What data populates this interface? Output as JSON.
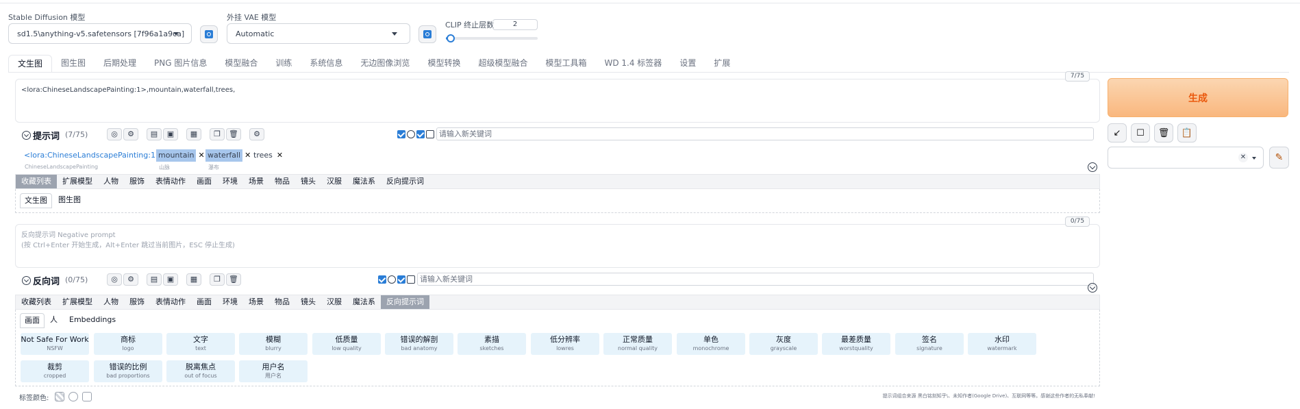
{
  "top": {
    "model_label": "Stable Diffusion 模型",
    "model_value": "sd1.5\\anything-v5.safetensors [7f96a1a9ca]",
    "vae_label": "外挂 VAE 模型",
    "vae_value": "Automatic",
    "clip_label": "CLIP 终止层数",
    "clip_value": "2"
  },
  "tabs": [
    "文生图",
    "图生图",
    "后期处理",
    "PNG 图片信息",
    "模型融合",
    "训练",
    "系统信息",
    "无边图像浏览",
    "模型转换",
    "超级模型融合",
    "模型工具箱",
    "WD 1.4 标签器",
    "设置",
    "扩展"
  ],
  "prompt": {
    "text": "<lora:ChineseLandscapePainting:1>,mountain,waterfall,trees,",
    "counter": "7/75",
    "title": "提示词",
    "count": "(7/75)",
    "kw_placeholder": "请输入新关键词",
    "tags": [
      {
        "text": "<lora:ChineseLandscapePainting:1>",
        "sub": "ChineseLandscapePainting"
      },
      {
        "text": "mountain",
        "sub": "山脉"
      },
      {
        "text": "waterfall",
        "sub": "瀑布"
      },
      {
        "text": "trees",
        "sub": ""
      }
    ],
    "categories": [
      "收藏列表",
      "扩展模型",
      "人物",
      "服饰",
      "表情动作",
      "画面",
      "环境",
      "场景",
      "物品",
      "镜头",
      "汉服",
      "魔法系",
      "反向提示词"
    ],
    "subtabs": [
      "文生图",
      "图生图"
    ]
  },
  "negative": {
    "placeholder_line1": "反向提示词 Negative prompt",
    "placeholder_line2": "(按 Ctrl+Enter 开始生成，Alt+Enter 跳过当前图片，ESC 停止生成)",
    "counter": "0/75",
    "title": "反向词",
    "count": "(0/75)",
    "kw_placeholder": "请输入新关键词",
    "categories": [
      "收藏列表",
      "扩展模型",
      "人物",
      "服饰",
      "表情动作",
      "画面",
      "环境",
      "场景",
      "物品",
      "镜头",
      "汉服",
      "魔法系",
      "反向提示词"
    ],
    "subtabs": [
      "画面",
      "人",
      "Embeddings"
    ],
    "cards": [
      {
        "m": "Not Safe For Work",
        "e": "NSFW"
      },
      {
        "m": "商标",
        "e": "logo"
      },
      {
        "m": "文字",
        "e": "text"
      },
      {
        "m": "模糊",
        "e": "blurry"
      },
      {
        "m": "低质量",
        "e": "low quality"
      },
      {
        "m": "错误的解剖",
        "e": "bad anatomy"
      },
      {
        "m": "素描",
        "e": "sketches"
      },
      {
        "m": "低分辨率",
        "e": "lowres"
      },
      {
        "m": "正常质量",
        "e": "normal quality"
      },
      {
        "m": "单色",
        "e": "monochrome"
      },
      {
        "m": "灰度",
        "e": "grayscale"
      },
      {
        "m": "最差质量",
        "e": "worstquality"
      },
      {
        "m": "签名",
        "e": "signature"
      },
      {
        "m": "水印",
        "e": "watermark"
      },
      {
        "m": "裁剪",
        "e": "cropped"
      },
      {
        "m": "错误的比例",
        "e": "bad proportions"
      },
      {
        "m": "脱离焦点",
        "e": "out of focus"
      },
      {
        "m": "用户名",
        "e": "用户名"
      }
    ]
  },
  "footer": {
    "tag_color_label": "标签颜色:",
    "notice": "提示词组合来源 黑白铭刻知乎\\、未知作者(Google Drive)、互联网等等。感谢这些作者的无私奉献!"
  },
  "right": {
    "generate_label": "生成"
  },
  "colors": {
    "accent": "#2a7dd6",
    "generate": "#ea580c",
    "tag_highlight": "#a7c6ec",
    "card_bg": "#e6f3fb"
  },
  "icons": [
    "refresh-icon",
    "globe-icon",
    "gear-icon",
    "copy-icon",
    "trash-icon",
    "clock-icon",
    "collapse-icon",
    "arrow-icon",
    "square-icon",
    "clipboard-icon",
    "pencil-icon"
  ]
}
